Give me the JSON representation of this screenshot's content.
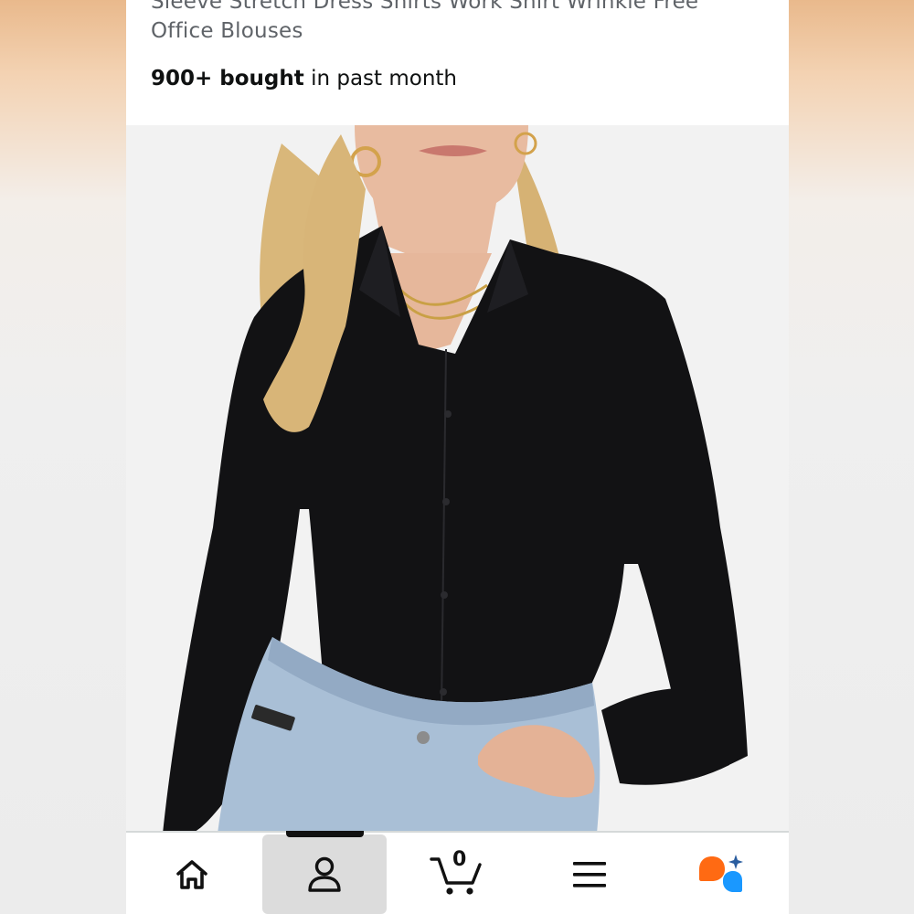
{
  "product": {
    "title": "Sleeve Stretch Dress Shirts Work Shirt Wrinkle Free Office Blouses",
    "bought_count": "900+ bought",
    "bought_suffix": " in past month",
    "image_alt": "Woman wearing black long sleeve button-down shirt with light wash jeans"
  },
  "bottom_nav": {
    "items": [
      {
        "name": "home",
        "icon": "home-icon",
        "active": false
      },
      {
        "name": "account",
        "icon": "user-icon",
        "active": true
      },
      {
        "name": "cart",
        "icon": "cart-icon",
        "count": "0",
        "active": false
      },
      {
        "name": "menu",
        "icon": "menu-icon",
        "active": false
      },
      {
        "name": "rufus",
        "icon": "ai-assistant-icon",
        "active": false
      }
    ]
  },
  "colors": {
    "title_text": "#5f6368",
    "body_text": "#0f1111",
    "nav_active_bg": "#dcdcdc",
    "assistant_orange": "#ff6a13",
    "assistant_blue": "#1a98ff"
  }
}
